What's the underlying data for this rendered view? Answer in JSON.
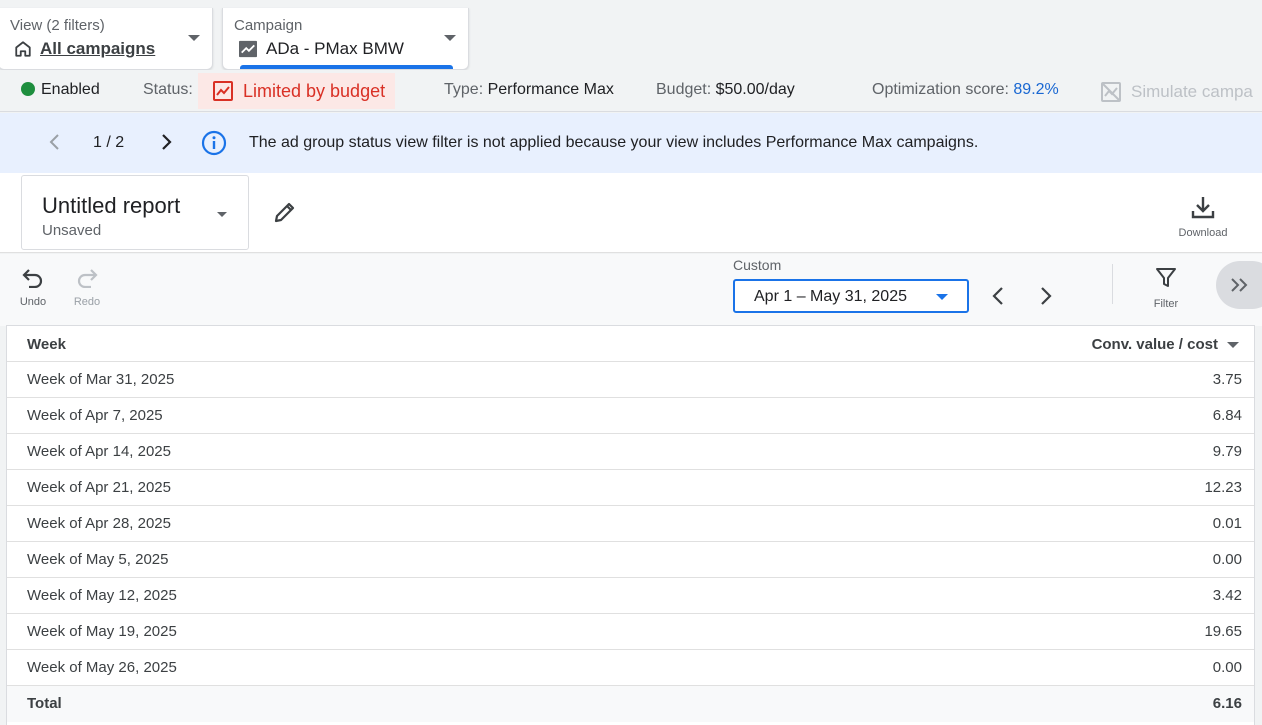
{
  "view_selector": {
    "caption": "View (2 filters)",
    "value": "All campaigns",
    "icon": "home-icon"
  },
  "campaign_selector": {
    "caption": "Campaign",
    "value": "ADa - PMax BMW",
    "icon": "trending-icon"
  },
  "status_bar": {
    "enabled_label": "Enabled",
    "enabled_color": "#1e8e3e",
    "status_label": "Status:",
    "status_value": "Limited by budget",
    "status_color": "#d93025",
    "type_label": "Type:",
    "type_value": "Performance Max",
    "budget_label": "Budget:",
    "budget_value": "$50.00/day",
    "optimization_label": "Optimization score:",
    "optimization_value": "89.2%",
    "simulate_label": "Simulate campa"
  },
  "info_bar": {
    "pager": "1 / 2",
    "message": "The ad group status view filter is not applied because your view includes Performance Max campaigns."
  },
  "report": {
    "title": "Untitled report",
    "subtitle": "Unsaved",
    "download_label": "Download"
  },
  "toolbar": {
    "undo_label": "Undo",
    "redo_label": "Redo",
    "date_caption": "Custom",
    "date_range": "Apr 1 – May 31, 2025",
    "filter_label": "Filter"
  },
  "table": {
    "headers": {
      "week": "Week",
      "metric": "Conv. value / cost"
    },
    "rows": [
      {
        "week": "Week of Mar 31, 2025",
        "value": "3.75"
      },
      {
        "week": "Week of Apr 7, 2025",
        "value": "6.84"
      },
      {
        "week": "Week of Apr 14, 2025",
        "value": "9.79"
      },
      {
        "week": "Week of Apr 21, 2025",
        "value": "12.23"
      },
      {
        "week": "Week of Apr 28, 2025",
        "value": "0.01"
      },
      {
        "week": "Week of May 5, 2025",
        "value": "0.00"
      },
      {
        "week": "Week of May 12, 2025",
        "value": "3.42"
      },
      {
        "week": "Week of May 19, 2025",
        "value": "19.65"
      },
      {
        "week": "Week of May 26, 2025",
        "value": "0.00"
      }
    ],
    "total": {
      "label": "Total",
      "value": "6.16"
    }
  },
  "colors": {
    "accent": "#1a73e8",
    "info_bg": "#e8f0fe",
    "limited_bg": "#fce8e6"
  }
}
